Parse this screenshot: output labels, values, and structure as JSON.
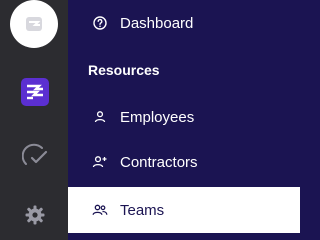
{
  "rail": {
    "icons": [
      "avatar-logo-icon",
      "app-layers-icon",
      "check-gauge-icon",
      "gear-icon"
    ],
    "accent_color": "#5b2fd1",
    "rail_color": "#2c2c30"
  },
  "menu": {
    "dashboard_label": "Dashboard",
    "section_title": "Resources",
    "items": [
      {
        "label": "Employees",
        "icon": "person-icon"
      },
      {
        "label": "Contractors",
        "icon": "person-plus-icon"
      },
      {
        "label": "Teams",
        "icon": "people-icon",
        "active": true
      }
    ],
    "background_color": "#1b1452",
    "active_background_color": "#ffffff"
  }
}
